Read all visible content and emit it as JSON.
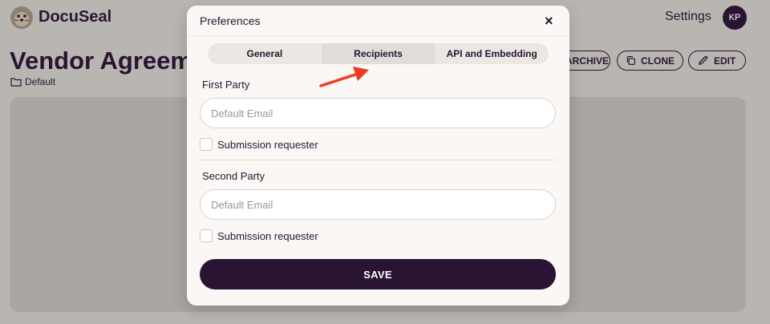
{
  "app": {
    "brand": "DocuSeal",
    "settings_label": "Settings",
    "avatar_initials": "KP"
  },
  "document": {
    "title": "Vendor Agreeme",
    "folder": "Default"
  },
  "actions": {
    "archive_label": "ARCHIVE",
    "clone_label": "CLONE",
    "edit_label": "EDIT"
  },
  "modal": {
    "title": "Preferences",
    "close_symbol": "×",
    "tabs": [
      {
        "label": "General",
        "active": false
      },
      {
        "label": "Recipients",
        "active": true
      },
      {
        "label": "API and Embedding",
        "active": false
      }
    ],
    "first_party": {
      "label": "First Party",
      "email_placeholder": "Default Email",
      "checkbox_label": "Submission requester",
      "checked": false
    },
    "second_party": {
      "label": "Second Party",
      "email_placeholder": "Default Email",
      "checkbox_label": "Submission requester",
      "checked": false
    },
    "save_label": "SAVE"
  },
  "colors": {
    "primary": "#2a1433",
    "overlay_bg": "#b9b6b1",
    "modal_bg": "#fbf7f4",
    "annotation_arrow": "#ee3b22"
  },
  "icons": [
    "docuseal-logo-icon",
    "folder-icon",
    "clone-icon",
    "pencil-icon",
    "close-icon",
    "annotation-arrow-icon"
  ]
}
